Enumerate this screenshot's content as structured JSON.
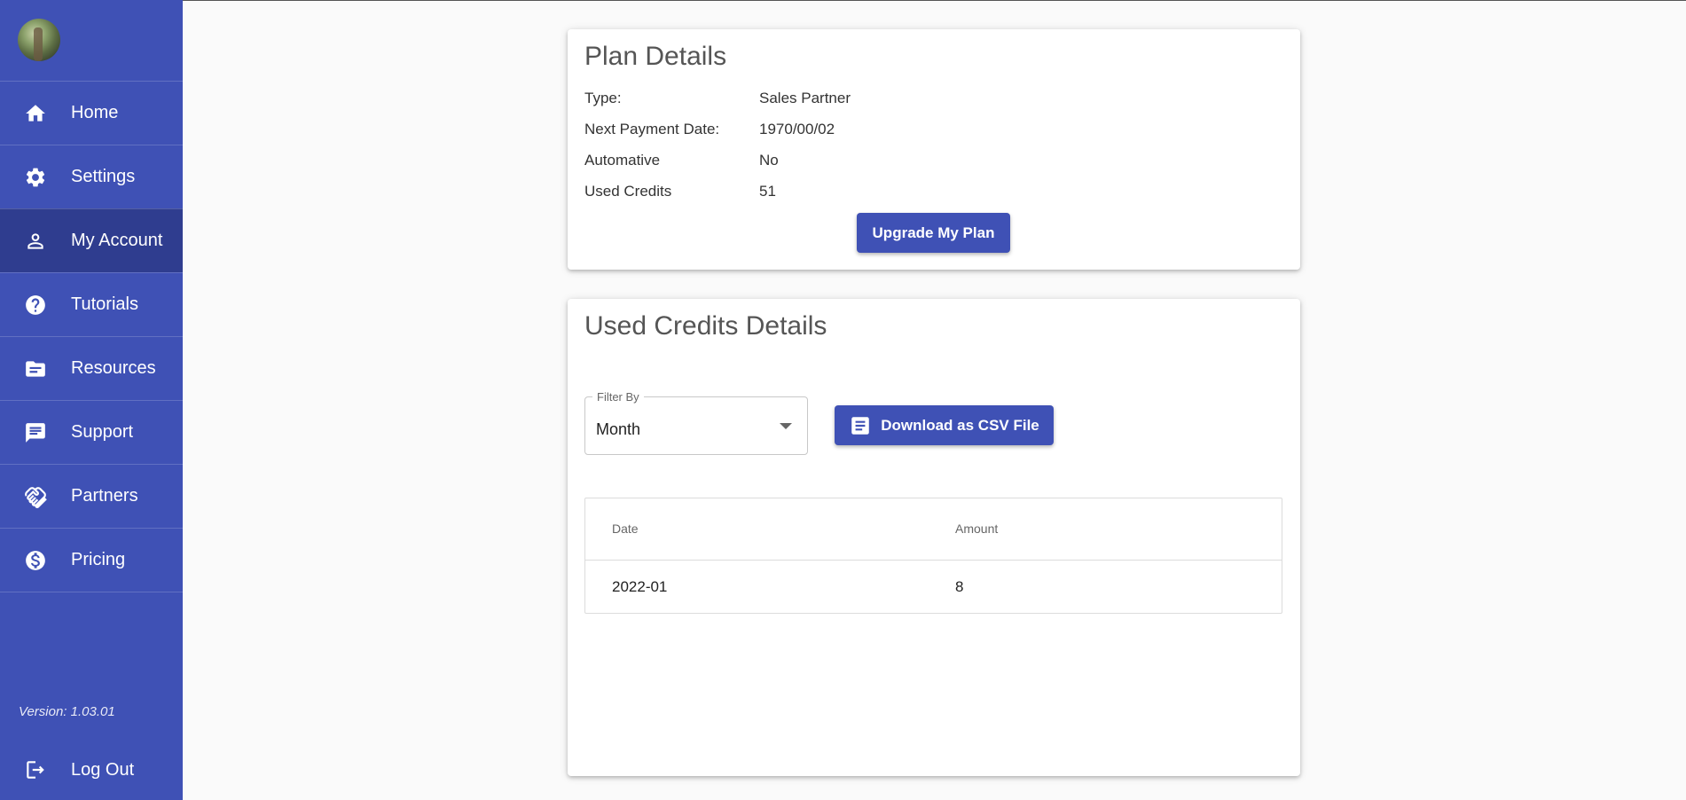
{
  "sidebar": {
    "items": [
      {
        "label": "Home",
        "icon": "home-icon",
        "active": false
      },
      {
        "label": "Settings",
        "icon": "gear-icon",
        "active": false
      },
      {
        "label": "My Account",
        "icon": "person-icon",
        "active": true
      },
      {
        "label": "Tutorials",
        "icon": "help-icon",
        "active": false
      },
      {
        "label": "Resources",
        "icon": "folder-icon",
        "active": false
      },
      {
        "label": "Support",
        "icon": "chat-icon",
        "active": false
      },
      {
        "label": "Partners",
        "icon": "handshake-icon",
        "active": false
      },
      {
        "label": "Pricing",
        "icon": "dollar-icon",
        "active": false
      }
    ],
    "version": "Version: 1.03.01",
    "logout_label": "Log Out"
  },
  "plan": {
    "title": "Plan Details",
    "rows": [
      {
        "key": "Type:",
        "value": "Sales Partner"
      },
      {
        "key": "Next Payment Date:",
        "value": "1970/00/02"
      },
      {
        "key": "Automative",
        "value": "No"
      },
      {
        "key": "Used Credits",
        "value": "51"
      }
    ],
    "upgrade_label": "Upgrade My Plan"
  },
  "credits": {
    "title": "Used Credits Details",
    "filter": {
      "label": "Filter By",
      "value": "Month"
    },
    "download_label": "Download as CSV File",
    "table": {
      "headers": [
        "Date",
        "Amount"
      ],
      "rows": [
        [
          "2022-01",
          "8"
        ]
      ]
    }
  },
  "colors": {
    "primary": "#3f51b5",
    "sidebar_active": "#2f3d8f",
    "background": "#fafafa"
  }
}
